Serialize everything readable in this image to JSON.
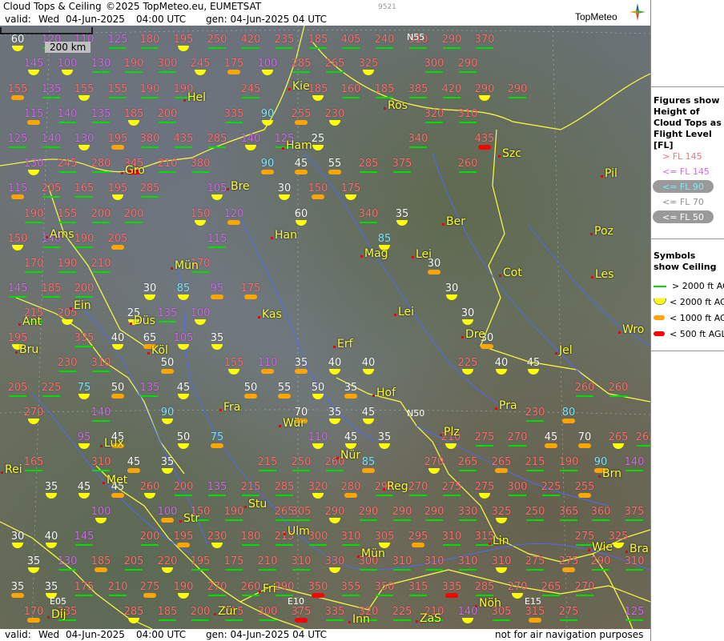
{
  "header": {
    "title": "Cloud Tops & Ceiling",
    "copyright": "©2025 TopMeteo.eu, EUMETSAT",
    "valid_label": "valid:",
    "valid_day": "Wed",
    "valid_date": "04-Jun-2025",
    "valid_time": "04:00 UTC",
    "gen_label": "gen: 04-Jun-2025 04 UTC",
    "code": "9521",
    "logo": "TopMeteo"
  },
  "footer": {
    "valid_label": "valid:",
    "valid_day": "Wed",
    "valid_date": "04-Jun-2025",
    "valid_time": "04:00 UTC",
    "gen_label": "gen: 04-Jun-2025 04 UTC",
    "disclaimer": "not for air navigation purposes"
  },
  "scale": {
    "label": "200 km"
  },
  "colors": {
    "high": "#ff7070",
    "mid": "#d16ee8",
    "low": "#7fe8ff",
    "lower": "#ffffff",
    "lowest": "#ffffff",
    "ceil_green": "#00dd00",
    "ceil_yellow": "#ffff00",
    "ceil_orange": "#ffa500",
    "ceil_red": "#ff0000"
  },
  "legend": {
    "title1": "Figures show Height of Cloud Tops as Flight Level [FL]",
    "fl_items": [
      {
        "text": "> FL 145",
        "color": "#ff7070",
        "pill": false
      },
      {
        "text": "<= FL 145",
        "color": "#d16ee8",
        "pill": false
      },
      {
        "text": "<= FL 90",
        "color": "#7fe8ff",
        "pill": true
      },
      {
        "text": "<= FL 70",
        "color": "#909090",
        "pill": false
      },
      {
        "text": "<= FL 50",
        "color": "#ffffff",
        "pill": true
      }
    ],
    "title2": "Symbols show Ceiling",
    "ceil_items": [
      {
        "text": "> 2000 ft AGL",
        "sym": "line",
        "color": "#00dd00"
      },
      {
        "text": "< 2000 ft AGL",
        "sym": "half",
        "color": "#ffff00"
      },
      {
        "text": "< 1000 ft AGL",
        "sym": "bar",
        "color": "#ffa500"
      },
      {
        "text": "< 500 ft AGL",
        "sym": "bar",
        "color": "#ff0000"
      }
    ]
  },
  "grid_labels": [
    {
      "text": "N55"
    },
    {
      "text": "N50"
    },
    {
      "text": "E05"
    },
    {
      "text": "E10"
    },
    {
      "text": "E15"
    }
  ],
  "cities": [
    "Hel",
    "Kie",
    "Ros",
    "Ham",
    "Szc",
    "Gro",
    "Bre",
    "Pil",
    "Ber",
    "Han",
    "Poz",
    "Ams",
    "Mag",
    "Lei",
    "Cot",
    "Mün",
    "Les",
    "Kas",
    "Ein",
    "Lei",
    "Ant",
    "Düs",
    "Dre",
    "Wro",
    "Erf",
    "Bru",
    "Köl",
    "Jel",
    "Hof",
    "Fra",
    "Pra",
    "Lux",
    "Wür",
    "Plz",
    "Nür",
    "Rei",
    "Met",
    "Reg",
    "Brn",
    "Stu",
    "Str",
    "Ulm",
    "Lin",
    "Mün",
    "Wie",
    "Bra",
    "Fri",
    "Nöh",
    "Zür",
    "Inn",
    "ZaS",
    "Dij"
  ],
  "values": [
    "60",
    "120",
    "110",
    "125",
    "180",
    "195",
    "250",
    "420",
    "235",
    "185",
    "405",
    "240",
    "310",
    "290",
    "370",
    "145",
    "100",
    "130",
    "190",
    "300",
    "245",
    "175",
    "100",
    "285",
    "265",
    "325",
    "300",
    "290",
    "155",
    "135",
    "155",
    "155",
    "190",
    "190",
    "245",
    "185",
    "160",
    "185",
    "385",
    "420",
    "290",
    "290",
    "115",
    "140",
    "135",
    "185",
    "200",
    "335",
    "90",
    "255",
    "230",
    "320",
    "310",
    "125",
    "140",
    "130",
    "195",
    "380",
    "435",
    "285",
    "140",
    "125",
    "25",
    "340",
    "435",
    "130",
    "245",
    "280",
    "345",
    "210",
    "380",
    "90",
    "45",
    "55",
    "285",
    "375",
    "260",
    "115",
    "205",
    "165",
    "195",
    "285",
    "105",
    "30",
    "150",
    "175",
    "190",
    "155",
    "200",
    "200",
    "150",
    "120",
    "60",
    "340",
    "35",
    "150",
    "140",
    "190",
    "205",
    "115",
    "85",
    "170",
    "190",
    "210",
    "170",
    "30",
    "145",
    "185",
    "200",
    "30",
    "85",
    "95",
    "175",
    "30",
    "215",
    "205",
    "25",
    "135",
    "100",
    "30",
    "195",
    "335",
    "40",
    "65",
    "105",
    "35",
    "30",
    "230",
    "310",
    "50",
    "155",
    "110",
    "35",
    "40",
    "40",
    "225",
    "40",
    "45",
    "205",
    "225",
    "75",
    "50",
    "135",
    "45",
    "50",
    "55",
    "50",
    "35",
    "260",
    "260",
    "270",
    "140",
    "90",
    "70",
    "35",
    "45",
    "230",
    "80",
    "95",
    "45",
    "50",
    "75",
    "110",
    "45",
    "35",
    "210",
    "275",
    "270",
    "45",
    "70",
    "265",
    "265",
    "165",
    "310",
    "45",
    "35",
    "215",
    "250",
    "260",
    "85",
    "270",
    "265",
    "265",
    "215",
    "190",
    "90",
    "140",
    "35",
    "45",
    "45",
    "260",
    "200",
    "135",
    "215",
    "285",
    "320",
    "280",
    "290",
    "270",
    "275",
    "275",
    "300",
    "225",
    "255",
    "100",
    "100",
    "150",
    "190",
    "265",
    "305",
    "290",
    "290",
    "290",
    "290",
    "330",
    "325",
    "250",
    "365",
    "360",
    "375",
    "30",
    "40",
    "145",
    "200",
    "195",
    "230",
    "180",
    "215",
    "300",
    "310",
    "305",
    "295",
    "310",
    "315",
    "275",
    "325",
    "35",
    "130",
    "185",
    "205",
    "220",
    "195",
    "175",
    "210",
    "310",
    "330",
    "300",
    "310",
    "310",
    "310",
    "310",
    "275",
    "275",
    "290",
    "310",
    "35",
    "35",
    "175",
    "210",
    "275",
    "190",
    "270",
    "260",
    "290",
    "350",
    "355",
    "350",
    "315",
    "335",
    "285",
    "270",
    "265",
    "270",
    "170",
    "235",
    "285",
    "185",
    "200",
    "215",
    "300",
    "375",
    "335",
    "320",
    "225",
    "210",
    "140",
    "305",
    "315",
    "275",
    "125"
  ]
}
